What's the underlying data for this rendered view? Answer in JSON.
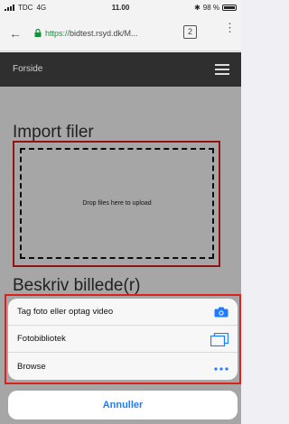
{
  "status_bar": {
    "carrier": "TDC",
    "network": "4G",
    "time": "11.00",
    "battery": "98 %"
  },
  "browser": {
    "url_scheme": "https://",
    "url_rest": "bidtest.rsyd.dk/M...",
    "tab_count": "2"
  },
  "site_nav": {
    "title": "Forside"
  },
  "page": {
    "heading": "Import filer",
    "dropzone_text": "Drop files here to upload",
    "heading2": "Beskriv billede(r)"
  },
  "action_sheet": {
    "items": [
      {
        "label": "Tag foto eller optag video",
        "icon": "camera-icon"
      },
      {
        "label": "Fotobibliotek",
        "icon": "photo-library-icon"
      },
      {
        "label": "Browse",
        "icon": "more-dots-icon"
      }
    ],
    "cancel": "Annuller"
  },
  "colors": {
    "accent": "#1f7bff",
    "highlight": "#e0201c",
    "nav_bg": "#2f2f2f"
  }
}
